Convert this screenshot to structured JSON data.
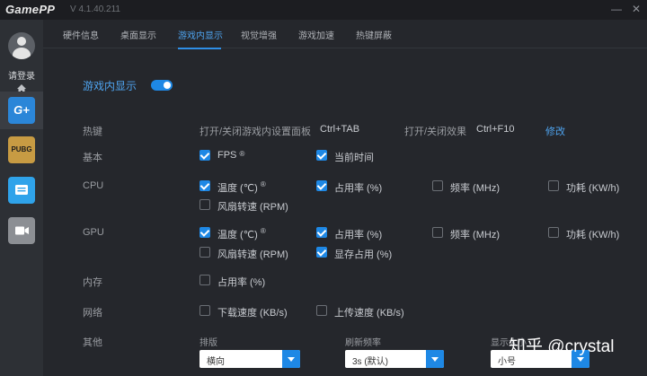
{
  "app": {
    "name": "GamePP",
    "version": "V 4.1.40.211"
  },
  "window_controls": {
    "minimize": "—",
    "close": "✕"
  },
  "sidebar": {
    "login": "请登录",
    "pubg": "PUBG",
    "gplus": "G+"
  },
  "tabs": [
    {
      "label": "硬件信息"
    },
    {
      "label": "桌面显示"
    },
    {
      "label": "游戏内显示"
    },
    {
      "label": "视觉增强"
    },
    {
      "label": "游戏加速"
    },
    {
      "label": "热键屏蔽"
    }
  ],
  "section": {
    "title": "游戏内显示",
    "enabled": true
  },
  "hotkeys": {
    "label": "热键",
    "panel_text": "打开/关闭游戏内设置面板",
    "panel_key": "Ctrl+TAB",
    "effect_text": "打开/关闭效果",
    "effect_key": "Ctrl+F10",
    "modify": "修改"
  },
  "basic": {
    "label": "基本",
    "fps": "FPS",
    "fps_mark": "®",
    "time": "当前时间"
  },
  "cpu": {
    "label": "CPU",
    "temp": "温度 (℃)",
    "temp_mark": "®",
    "usage": "占用率 (%)",
    "freq": "频率 (MHz)",
    "power": "功耗 (KW/h)",
    "fan": "风扇转速 (RPM)"
  },
  "gpu": {
    "label": "GPU",
    "temp": "温度 (℃)",
    "temp_mark": "®",
    "usage": "占用率 (%)",
    "freq": "频率 (MHz)",
    "power": "功耗 (KW/h)",
    "fan": "风扇转速 (RPM)",
    "vram": "显存占用 (%)"
  },
  "memory": {
    "label": "内存",
    "usage": "占用率 (%)"
  },
  "network": {
    "label": "网络",
    "download": "下载速度 (KB/s)",
    "upload": "上传速度 (KB/s)"
  },
  "other": {
    "label": "其他",
    "layout_label": "排版",
    "layout_value": "横向",
    "refresh_label": "刷新频率",
    "refresh_value": "3s (默认)",
    "size_label": "显示大小",
    "size_value": "小号"
  },
  "watermark": "知乎 @crystal",
  "colors": {
    "accent": "#1e88e5",
    "bg": "#25272c",
    "sidebar": "#2d3035"
  }
}
